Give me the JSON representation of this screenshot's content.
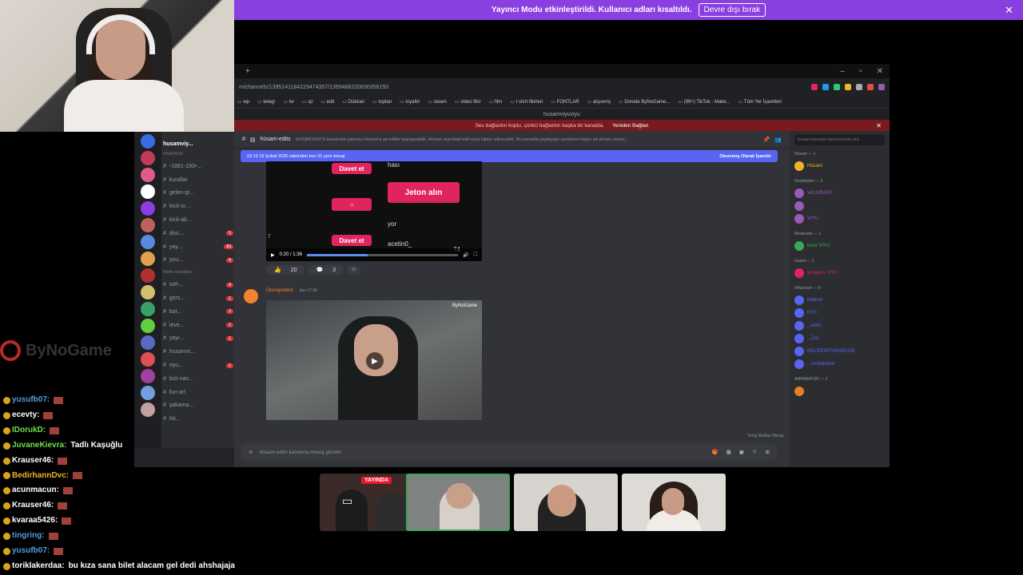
{
  "banner": {
    "text": "Yayıncı Modu etkinleştirildi. Kullanıcı adları kısaltıldı.",
    "button": "Devre dışı bırak"
  },
  "browser": {
    "url": "m/channels/1395141184229474357/1399488220630356150",
    "bookmarks": [
      "wp",
      "telegr",
      "tw",
      "sp",
      "edit",
      "Dükkan",
      "toptan",
      "kıyafet",
      "steam",
      "video fikir",
      "film",
      "t shirt fikirleri",
      "FONTLAR",
      "alışveriş",
      "Donate ByNoGame...",
      "(99+) TikTok - Make...",
      "Tüm Yer İşaretleri"
    ],
    "title": "husamviyuviyu"
  },
  "discord": {
    "connection_error": "Ses bağlantın koptu, çünkü bağlantın başka bir kanalda.",
    "reconnect": "Yeniden Bağlan",
    "server_name": "husamviy...",
    "category1": "ANAYASA",
    "category2": "Metin Kanalları",
    "channels_top": [
      {
        "name": "-1881-193•...",
        "badge": ""
      },
      {
        "name": "kurallar",
        "badge": ""
      },
      {
        "name": "gelen-gi...",
        "badge": ""
      },
      {
        "name": "kick-sı:...",
        "badge": ""
      },
      {
        "name": "kick-ab...",
        "badge": ""
      },
      {
        "name": "disc...",
        "badge": "5"
      },
      {
        "name": "yay...",
        "badge": "83"
      },
      {
        "name": "you...",
        "badge": "6"
      }
    ],
    "channels_text": [
      {
        "name": "soh...",
        "badge": "6"
      },
      {
        "name": "görs...",
        "badge": "1"
      },
      {
        "name": "bot...",
        "badge": "2"
      },
      {
        "name": "leve...",
        "badge": "1"
      },
      {
        "name": "yayı...",
        "badge": "1"
      },
      {
        "name": "husamvi...",
        "badge": ""
      },
      {
        "name": "oyu...",
        "badge": "1"
      },
      {
        "name": "bizi-nas...",
        "badge": ""
      },
      {
        "name": "fun-art",
        "badge": ""
      },
      {
        "name": "şakama...",
        "badge": ""
      },
      {
        "name": "hü...",
        "badge": ""
      }
    ],
    "channel_name": "hüsam-edits",
    "channel_topic": "HÜSAM EDITS kanalında yalnızca Hüsam'a ait editler paylaşılabilir. Hüsam dışındaki edit veya klipler silinecektir. Bu kanalda paylaşılan içeriklerin kişiye ait olması zorunl...",
    "new_messages": "03:15 16 Şubat 2026 vaktinden beri 31 yeni mesaj",
    "mark_read": "Okunmuş Olarak İşaretle",
    "video1": {
      "invite1": "Davet et",
      "jeton": "Jeton alın",
      "invite2": "Davet et",
      "text1": "hası",
      "text2": "yor",
      "text3": "acetin0_",
      "count": "74",
      "likes": "7",
      "time": "0:20 / 1:36",
      "tooltip": "0:19"
    },
    "reactions": [
      {
        "emoji": "👍",
        "count": "20"
      },
      {
        "emoji": "💬",
        "count": "3"
      }
    ],
    "msg2_author": "Omnipotent",
    "msg2_time": "dün 17:36",
    "video2_brand": "ByNoGame",
    "typing": "Yeniş Modları Mesaj",
    "composer_placeholder": "hüsam-edits kanalına mesaj gönder",
    "member_search": "husamviyuviyu sunucusunu ara",
    "member_groups": [
      {
        "title": "Hüsam — 1",
        "members": [
          "Hüsam"
        ]
      },
      {
        "title": "Destekçiler — 3",
        "members": [
          "VALORANT",
          "",
          "VIYU"
        ]
      },
      {
        "title": "Moderatör — 1",
        "members": [
          "külot VIYU"
        ]
      },
      {
        "title": "Guard — 1",
        "members": [
          "yengess VIYU"
        ]
      },
      {
        "title": "Influencer — 6",
        "members": [
          "bidemir",
          "KYC",
          "...edits",
          "...ZeL",
          "RECEPINTHEHOUSE",
          "...zmbakarlar"
        ]
      },
      {
        "title": "AMPARATOR — 2",
        "members": [
          ""
        ]
      }
    ]
  },
  "chat": [
    {
      "user": "yusufb07:",
      "color": "#4f9de0",
      "text": ""
    },
    {
      "user": "ecevty:",
      "color": "#ffffff",
      "text": ""
    },
    {
      "user": "IDorukD:",
      "color": "#6de04f",
      "text": ""
    },
    {
      "user": "JuvaneKievra:",
      "color": "#6de04f",
      "text": "Tadlı Kaşuğlu"
    },
    {
      "user": "Krauser46:",
      "color": "#ffffff",
      "text": ""
    },
    {
      "user": "BedirhannDvc:",
      "color": "#f0b32a",
      "text": ""
    },
    {
      "user": "acunmacun:",
      "color": "#ffffff",
      "text": ""
    },
    {
      "user": "Krauser46:",
      "color": "#ffffff",
      "text": ""
    },
    {
      "user": "kvaraa5426:",
      "color": "#ffffff",
      "text": ""
    },
    {
      "user": "tingring:",
      "color": "#4f9de0",
      "text": ""
    },
    {
      "user": "yusufb07:",
      "color": "#4f9de0",
      "text": ""
    },
    {
      "user": "toriklakerdaa:",
      "color": "#ffffff",
      "text": "bu kıza sana bilet alacam gel dedi ahshajaja"
    }
  ],
  "live_label": "YAYINDA",
  "colors": {
    "accent": "#8a3fe0",
    "discord_blurple": "#5865f2",
    "live_red": "#e8152d"
  }
}
